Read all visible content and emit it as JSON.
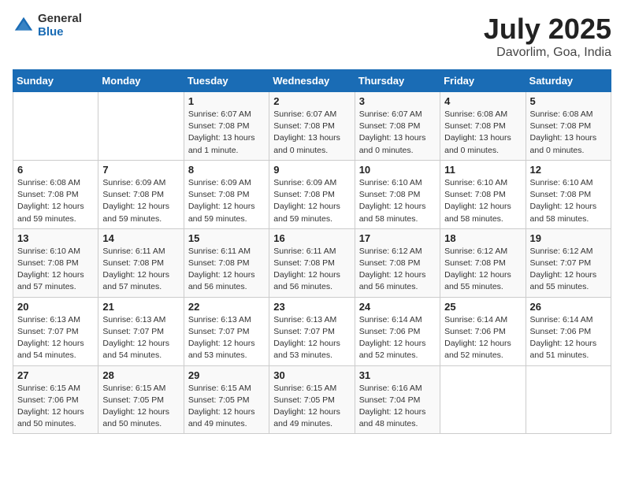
{
  "header": {
    "logo_general": "General",
    "logo_blue": "Blue",
    "month": "July 2025",
    "location": "Davorlim, Goa, India"
  },
  "weekdays": [
    "Sunday",
    "Monday",
    "Tuesday",
    "Wednesday",
    "Thursday",
    "Friday",
    "Saturday"
  ],
  "weeks": [
    [
      {
        "num": "",
        "info": ""
      },
      {
        "num": "",
        "info": ""
      },
      {
        "num": "1",
        "info": "Sunrise: 6:07 AM\nSunset: 7:08 PM\nDaylight: 13 hours\nand 1 minute."
      },
      {
        "num": "2",
        "info": "Sunrise: 6:07 AM\nSunset: 7:08 PM\nDaylight: 13 hours\nand 0 minutes."
      },
      {
        "num": "3",
        "info": "Sunrise: 6:07 AM\nSunset: 7:08 PM\nDaylight: 13 hours\nand 0 minutes."
      },
      {
        "num": "4",
        "info": "Sunrise: 6:08 AM\nSunset: 7:08 PM\nDaylight: 13 hours\nand 0 minutes."
      },
      {
        "num": "5",
        "info": "Sunrise: 6:08 AM\nSunset: 7:08 PM\nDaylight: 13 hours\nand 0 minutes."
      }
    ],
    [
      {
        "num": "6",
        "info": "Sunrise: 6:08 AM\nSunset: 7:08 PM\nDaylight: 12 hours\nand 59 minutes."
      },
      {
        "num": "7",
        "info": "Sunrise: 6:09 AM\nSunset: 7:08 PM\nDaylight: 12 hours\nand 59 minutes."
      },
      {
        "num": "8",
        "info": "Sunrise: 6:09 AM\nSunset: 7:08 PM\nDaylight: 12 hours\nand 59 minutes."
      },
      {
        "num": "9",
        "info": "Sunrise: 6:09 AM\nSunset: 7:08 PM\nDaylight: 12 hours\nand 59 minutes."
      },
      {
        "num": "10",
        "info": "Sunrise: 6:10 AM\nSunset: 7:08 PM\nDaylight: 12 hours\nand 58 minutes."
      },
      {
        "num": "11",
        "info": "Sunrise: 6:10 AM\nSunset: 7:08 PM\nDaylight: 12 hours\nand 58 minutes."
      },
      {
        "num": "12",
        "info": "Sunrise: 6:10 AM\nSunset: 7:08 PM\nDaylight: 12 hours\nand 58 minutes."
      }
    ],
    [
      {
        "num": "13",
        "info": "Sunrise: 6:10 AM\nSunset: 7:08 PM\nDaylight: 12 hours\nand 57 minutes."
      },
      {
        "num": "14",
        "info": "Sunrise: 6:11 AM\nSunset: 7:08 PM\nDaylight: 12 hours\nand 57 minutes."
      },
      {
        "num": "15",
        "info": "Sunrise: 6:11 AM\nSunset: 7:08 PM\nDaylight: 12 hours\nand 56 minutes."
      },
      {
        "num": "16",
        "info": "Sunrise: 6:11 AM\nSunset: 7:08 PM\nDaylight: 12 hours\nand 56 minutes."
      },
      {
        "num": "17",
        "info": "Sunrise: 6:12 AM\nSunset: 7:08 PM\nDaylight: 12 hours\nand 56 minutes."
      },
      {
        "num": "18",
        "info": "Sunrise: 6:12 AM\nSunset: 7:08 PM\nDaylight: 12 hours\nand 55 minutes."
      },
      {
        "num": "19",
        "info": "Sunrise: 6:12 AM\nSunset: 7:07 PM\nDaylight: 12 hours\nand 55 minutes."
      }
    ],
    [
      {
        "num": "20",
        "info": "Sunrise: 6:13 AM\nSunset: 7:07 PM\nDaylight: 12 hours\nand 54 minutes."
      },
      {
        "num": "21",
        "info": "Sunrise: 6:13 AM\nSunset: 7:07 PM\nDaylight: 12 hours\nand 54 minutes."
      },
      {
        "num": "22",
        "info": "Sunrise: 6:13 AM\nSunset: 7:07 PM\nDaylight: 12 hours\nand 53 minutes."
      },
      {
        "num": "23",
        "info": "Sunrise: 6:13 AM\nSunset: 7:07 PM\nDaylight: 12 hours\nand 53 minutes."
      },
      {
        "num": "24",
        "info": "Sunrise: 6:14 AM\nSunset: 7:06 PM\nDaylight: 12 hours\nand 52 minutes."
      },
      {
        "num": "25",
        "info": "Sunrise: 6:14 AM\nSunset: 7:06 PM\nDaylight: 12 hours\nand 52 minutes."
      },
      {
        "num": "26",
        "info": "Sunrise: 6:14 AM\nSunset: 7:06 PM\nDaylight: 12 hours\nand 51 minutes."
      }
    ],
    [
      {
        "num": "27",
        "info": "Sunrise: 6:15 AM\nSunset: 7:06 PM\nDaylight: 12 hours\nand 50 minutes."
      },
      {
        "num": "28",
        "info": "Sunrise: 6:15 AM\nSunset: 7:05 PM\nDaylight: 12 hours\nand 50 minutes."
      },
      {
        "num": "29",
        "info": "Sunrise: 6:15 AM\nSunset: 7:05 PM\nDaylight: 12 hours\nand 49 minutes."
      },
      {
        "num": "30",
        "info": "Sunrise: 6:15 AM\nSunset: 7:05 PM\nDaylight: 12 hours\nand 49 minutes."
      },
      {
        "num": "31",
        "info": "Sunrise: 6:16 AM\nSunset: 7:04 PM\nDaylight: 12 hours\nand 48 minutes."
      },
      {
        "num": "",
        "info": ""
      },
      {
        "num": "",
        "info": ""
      }
    ]
  ]
}
